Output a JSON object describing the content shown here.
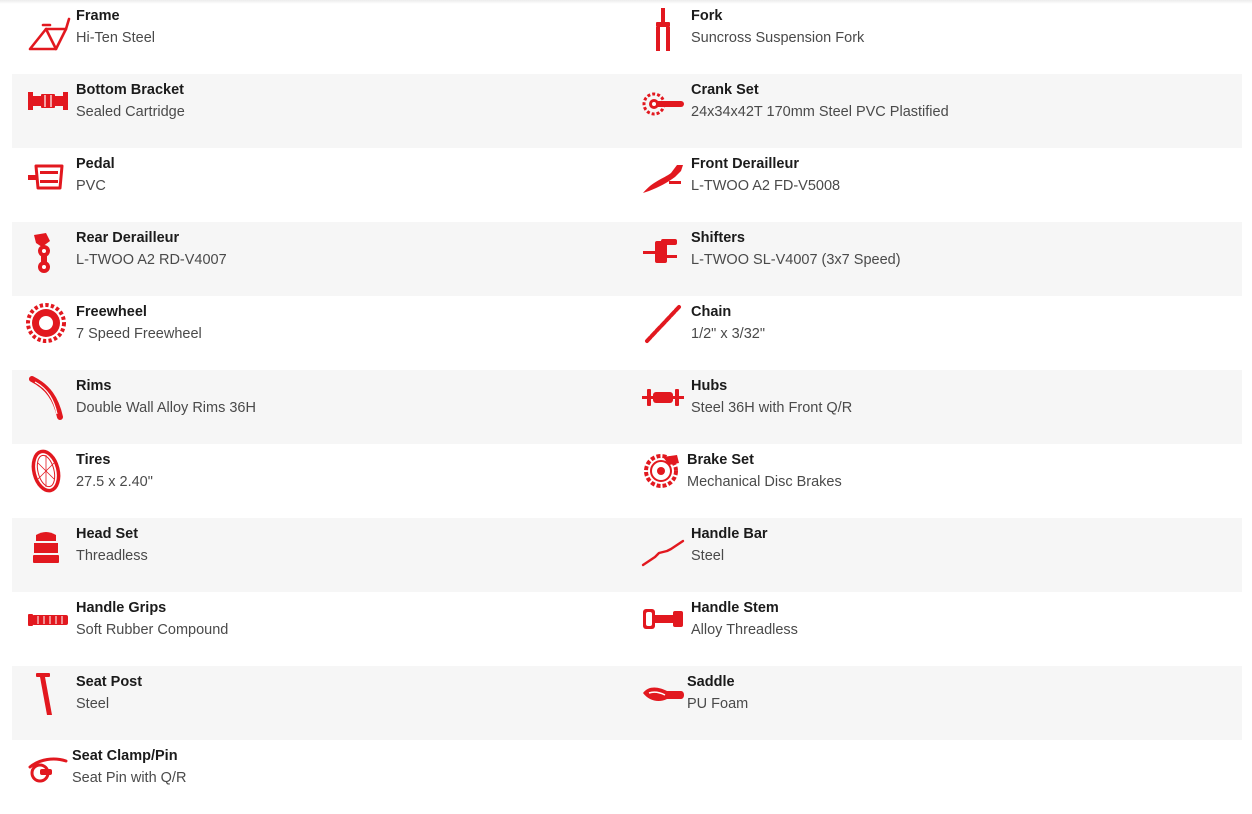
{
  "accent_color": "#e2181f",
  "specs": [
    {
      "name": "Frame",
      "value": "Hi-Ten Steel",
      "icon": "frame-icon"
    },
    {
      "name": "Fork",
      "value": "Suncross Suspension Fork",
      "icon": "fork-icon"
    },
    {
      "name": "Bottom Bracket",
      "value": "Sealed Cartridge",
      "icon": "bottom-bracket-icon"
    },
    {
      "name": "Crank Set",
      "value": "24x34x42T 170mm Steel PVC Plastified",
      "icon": "crank-set-icon"
    },
    {
      "name": "Pedal",
      "value": "PVC",
      "icon": "pedal-icon"
    },
    {
      "name": "Front Derailleur",
      "value": "L-TWOO A2 FD-V5008",
      "icon": "front-derailleur-icon"
    },
    {
      "name": "Rear Derailleur",
      "value": "L-TWOO A2 RD-V4007",
      "icon": "rear-derailleur-icon"
    },
    {
      "name": "Shifters",
      "value": "L-TWOO SL-V4007 (3x7 Speed)",
      "icon": "shifters-icon"
    },
    {
      "name": "Freewheel",
      "value": "7 Speed Freewheel",
      "icon": "freewheel-icon"
    },
    {
      "name": "Chain",
      "value": "1/2\" x 3/32\"",
      "icon": "chain-icon"
    },
    {
      "name": "Rims",
      "value": "Double Wall Alloy Rims 36H",
      "icon": "rims-icon"
    },
    {
      "name": "Hubs",
      "value": "Steel 36H with Front Q/R",
      "icon": "hubs-icon"
    },
    {
      "name": "Tires",
      "value": "27.5 x 2.40\"",
      "icon": "tires-icon"
    },
    {
      "name": "Brake Set",
      "value": "Mechanical Disc Brakes",
      "icon": "brake-set-icon"
    },
    {
      "name": "Head Set",
      "value": "Threadless",
      "icon": "head-set-icon"
    },
    {
      "name": "Handle Bar",
      "value": "Steel",
      "icon": "handle-bar-icon"
    },
    {
      "name": "Handle Grips",
      "value": "Soft Rubber Compound",
      "icon": "handle-grips-icon"
    },
    {
      "name": "Handle Stem",
      "value": "Alloy Threadless",
      "icon": "handle-stem-icon"
    },
    {
      "name": "Seat Post",
      "value": "Steel",
      "icon": "seat-post-icon"
    },
    {
      "name": "Saddle",
      "value": "PU Foam",
      "icon": "saddle-icon"
    },
    {
      "name": "Seat Clamp/Pin",
      "value": "Seat Pin with Q/R",
      "icon": "seat-clamp-icon"
    }
  ]
}
